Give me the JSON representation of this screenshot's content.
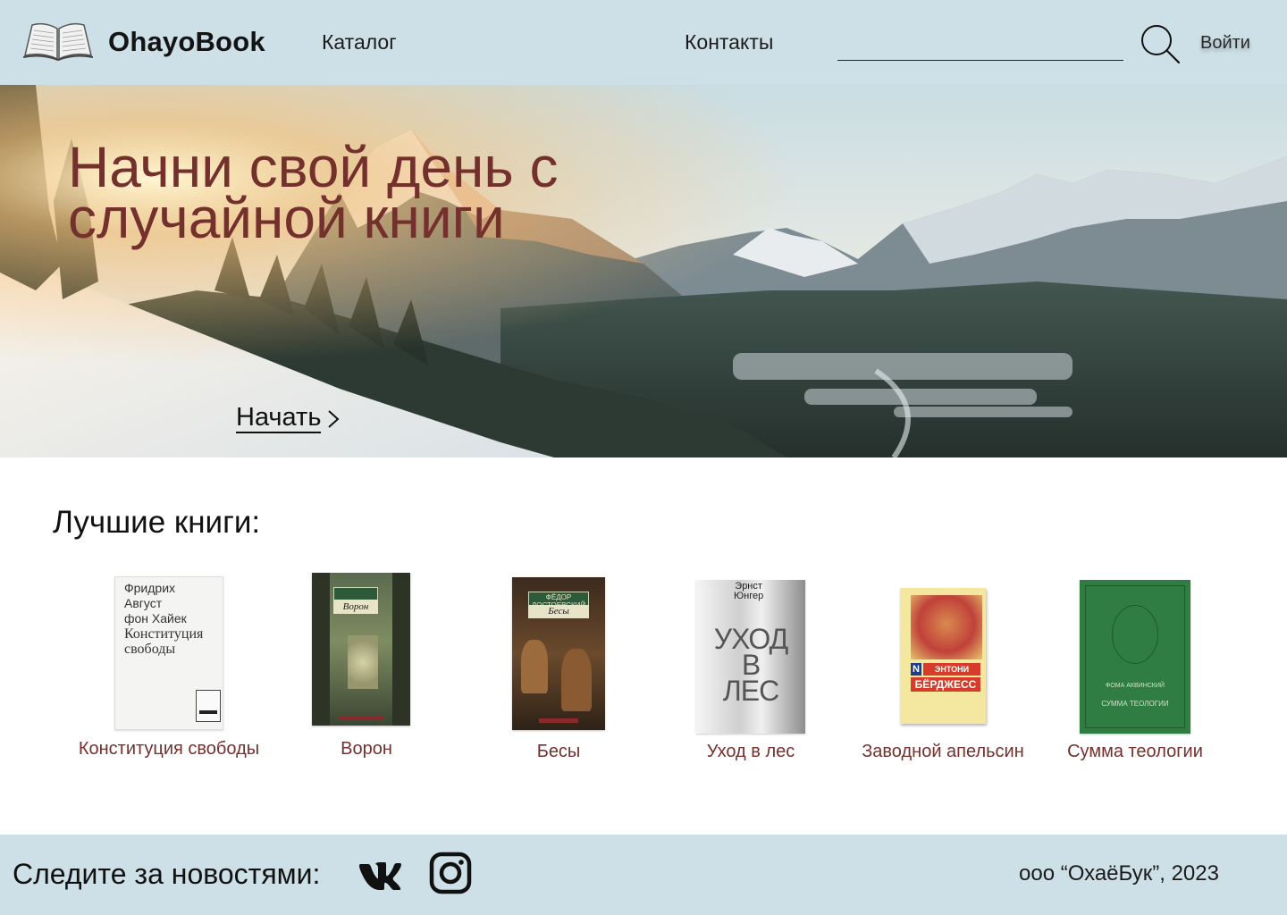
{
  "header": {
    "brand": "OhayoBook",
    "nav": {
      "catalog": "Каталог",
      "contacts": "Контакты"
    },
    "search": {
      "value": "",
      "placeholder": ""
    },
    "login": "Войти"
  },
  "hero": {
    "title": "Начни свой день с случайной книги",
    "cta": "Начать"
  },
  "books_section": {
    "title": "Лучшие книги:",
    "books": [
      {
        "title": "Конституция свободы",
        "cover_text": [
          "Фридрих",
          "Август",
          "фон Хайек",
          "Конституция",
          "свободы"
        ]
      },
      {
        "title": "Ворон",
        "cover_text": [
          "Ворон"
        ]
      },
      {
        "title": "Бесы",
        "cover_text": [
          "ФЁДОР ДОСТОЕВСКИЙ",
          "Бесы"
        ]
      },
      {
        "title": "Уход в лес",
        "cover_text": [
          "Эрнст",
          "Юнгер",
          "УХОД",
          "В",
          "ЛЕС"
        ]
      },
      {
        "title": "Заводной апельсин",
        "cover_text": [
          "ЭНТОНИ",
          "БЁРДЖЕСС"
        ]
      },
      {
        "title": "Сумма теологии",
        "cover_text": [
          "ФОМА АКВИНСКИЙ",
          "СУММА ТЕОЛОГИИ"
        ]
      }
    ]
  },
  "footer": {
    "follow": "Следите за новостями:",
    "copyright": "ооо “ОхаёБук”, 2023"
  },
  "colors": {
    "header_bg": "#cde0e7",
    "accent": "#74302d"
  },
  "icons": [
    "open-book-logo-icon",
    "search-icon",
    "chevron-right-icon",
    "vk-icon",
    "instagram-icon"
  ]
}
